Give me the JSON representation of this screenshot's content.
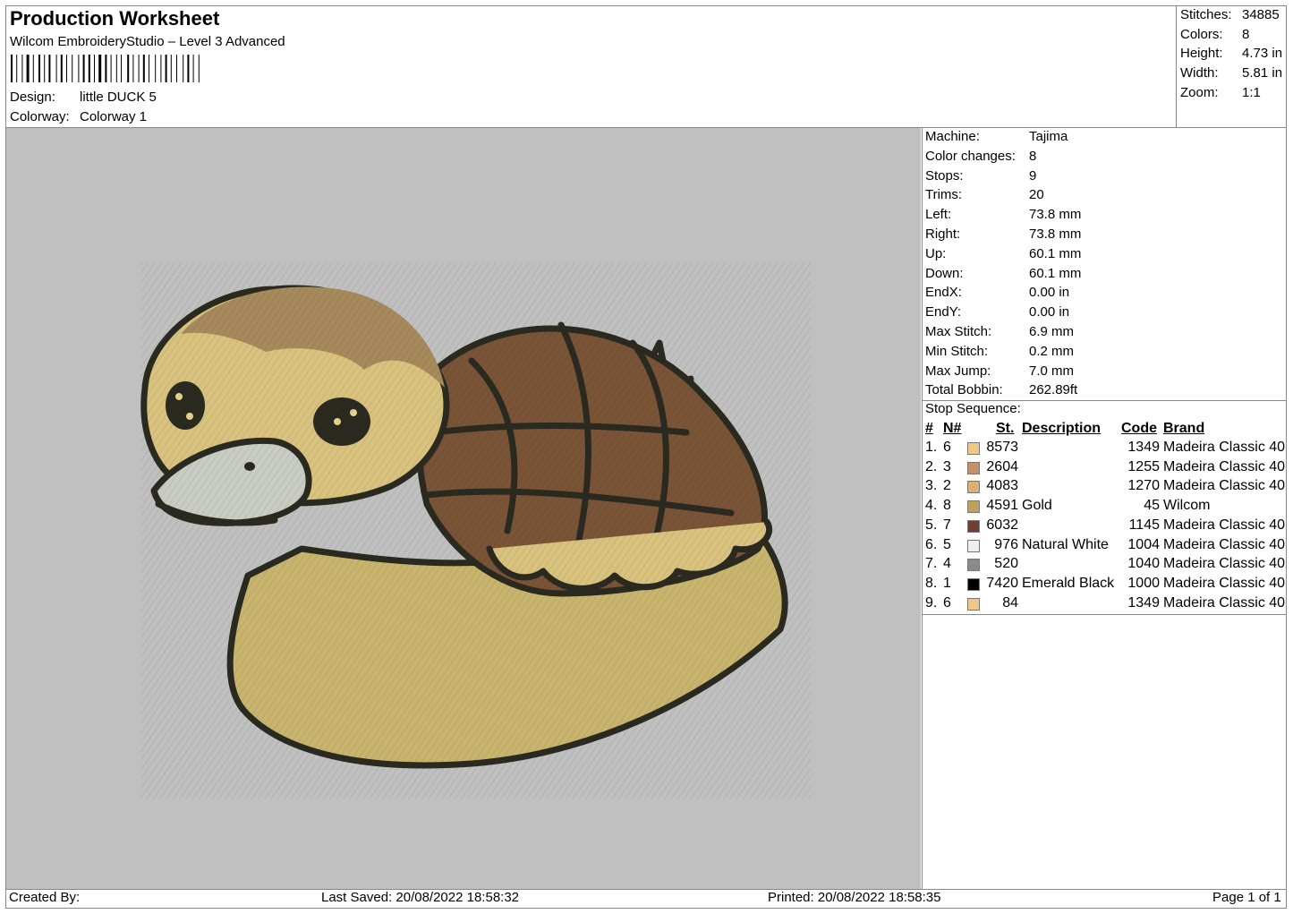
{
  "header": {
    "title": "Production Worksheet",
    "subtitle": "Wilcom EmbroideryStudio – Level 3 Advanced",
    "design_label": "Design:",
    "design_value": "little DUCK 5",
    "colorway_label": "Colorway:",
    "colorway_value": "Colorway 1"
  },
  "summary": {
    "stitches_label": "Stitches:",
    "stitches_value": "34885",
    "colors_label": "Colors:",
    "colors_value": "8",
    "height_label": "Height:",
    "height_value": "4.73 in",
    "width_label": "Width:",
    "width_value": "5.81 in",
    "zoom_label": "Zoom:",
    "zoom_value": "1:1"
  },
  "machine": {
    "rows": [
      {
        "label": "Machine:",
        "value": "Tajima"
      },
      {
        "label": "Color changes:",
        "value": "8"
      },
      {
        "label": "Stops:",
        "value": "9"
      },
      {
        "label": "Trims:",
        "value": "20"
      },
      {
        "label": "Left:",
        "value": "73.8 mm"
      },
      {
        "label": "Right:",
        "value": "73.8 mm"
      },
      {
        "label": "Up:",
        "value": "60.1 mm"
      },
      {
        "label": "Down:",
        "value": "60.1 mm"
      },
      {
        "label": "EndX:",
        "value": "0.00 in"
      },
      {
        "label": "EndY:",
        "value": "0.00 in"
      },
      {
        "label": "Max Stitch:",
        "value": "6.9 mm"
      },
      {
        "label": "Min Stitch:",
        "value": "0.2 mm"
      },
      {
        "label": "Max Jump:",
        "value": "7.0 mm"
      },
      {
        "label": "Total Bobbin:",
        "value": "262.89ft"
      }
    ]
  },
  "stop_sequence": {
    "title": "Stop Sequence:",
    "headers": {
      "num": "#",
      "n": "N#",
      "st": "St.",
      "description": "Description",
      "code": "Code",
      "brand": "Brand"
    },
    "rows": [
      {
        "idx": "1.",
        "n": "6",
        "color": "#f0c98a",
        "st": "8573",
        "description": "",
        "code": "1349",
        "brand": "Madeira Classic 40"
      },
      {
        "idx": "2.",
        "n": "3",
        "color": "#c8906a",
        "st": "2604",
        "description": "",
        "code": "1255",
        "brand": "Madeira Classic 40"
      },
      {
        "idx": "3.",
        "n": "2",
        "color": "#ddb07a",
        "st": "4083",
        "description": "",
        "code": "1270",
        "brand": "Madeira Classic 40"
      },
      {
        "idx": "4.",
        "n": "8",
        "color": "#c0a060",
        "st": "4591",
        "description": "Gold",
        "code": "45",
        "brand": "Wilcom"
      },
      {
        "idx": "5.",
        "n": "7",
        "color": "#6b4030",
        "st": "6032",
        "description": "",
        "code": "1145",
        "brand": "Madeira Classic 40"
      },
      {
        "idx": "6.",
        "n": "5",
        "color": "#f0f0f0",
        "st": "976",
        "description": "Natural White",
        "code": "1004",
        "brand": "Madeira Classic 40"
      },
      {
        "idx": "7.",
        "n": "4",
        "color": "#8a8a8a",
        "st": "520",
        "description": "",
        "code": "1040",
        "brand": "Madeira Classic 40"
      },
      {
        "idx": "8.",
        "n": "1",
        "color": "#000000",
        "st": "7420",
        "description": "Emerald Black",
        "code": "1000",
        "brand": "Madeira Classic 40"
      },
      {
        "idx": "9.",
        "n": "6",
        "color": "#f0c98a",
        "st": "84",
        "description": "",
        "code": "1349",
        "brand": "Madeira Classic 40"
      }
    ]
  },
  "footer": {
    "created_by": "Created By:",
    "last_saved": "Last Saved: 20/08/2022 18:58:32",
    "printed": "Printed: 20/08/2022 18:58:35",
    "page": "Page 1 of 1"
  },
  "colors": {
    "preview_bg": "#c0c0c0",
    "outline": "#2a2a20"
  }
}
